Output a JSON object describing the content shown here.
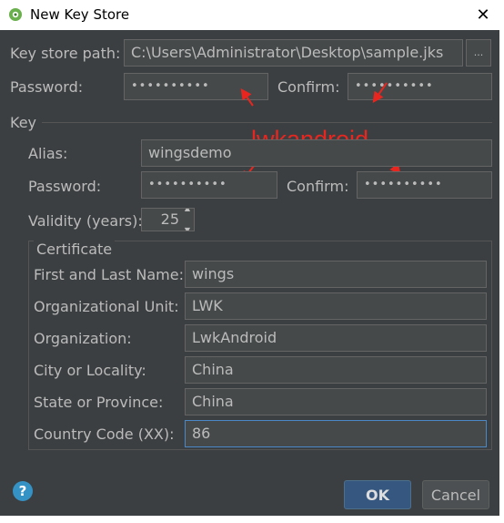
{
  "window": {
    "title": "New Key Store",
    "close": "✕"
  },
  "keystore": {
    "path_label": "Key store path:",
    "path_value": "C:\\Users\\Administrator\\Desktop\\sample.jks",
    "browse_label": "...",
    "password_label": "Password:",
    "password_value": "••••••••••",
    "confirm_label": "Confirm:",
    "confirm_value": "••••••••••"
  },
  "key": {
    "group_label": "Key",
    "alias_label": "Alias:",
    "alias_value": "wingsdemo",
    "password_label": "Password:",
    "password_value": "••••••••••",
    "confirm_label": "Confirm:",
    "confirm_value": "••••••••••",
    "validity_label": "Validity (years):",
    "validity_value": "25"
  },
  "certificate": {
    "group_label": "Certificate",
    "fields": [
      {
        "label": "First and Last Name:",
        "value": "wings"
      },
      {
        "label": "Organizational Unit:",
        "value": "LWK"
      },
      {
        "label": "Organization:",
        "value": "LwkAndroid"
      },
      {
        "label": "City or Locality:",
        "value": "China"
      },
      {
        "label": "State or Province:",
        "value": "China"
      },
      {
        "label": "Country Code (XX):",
        "value": "86"
      }
    ]
  },
  "annotation": {
    "text": "lwkandroid",
    "color": "#e8261f"
  },
  "buttons": {
    "ok": "OK",
    "cancel": "Cancel",
    "help": "?"
  },
  "icons": {
    "app": "android-studio-icon",
    "help": "help-icon",
    "close": "close-icon"
  }
}
